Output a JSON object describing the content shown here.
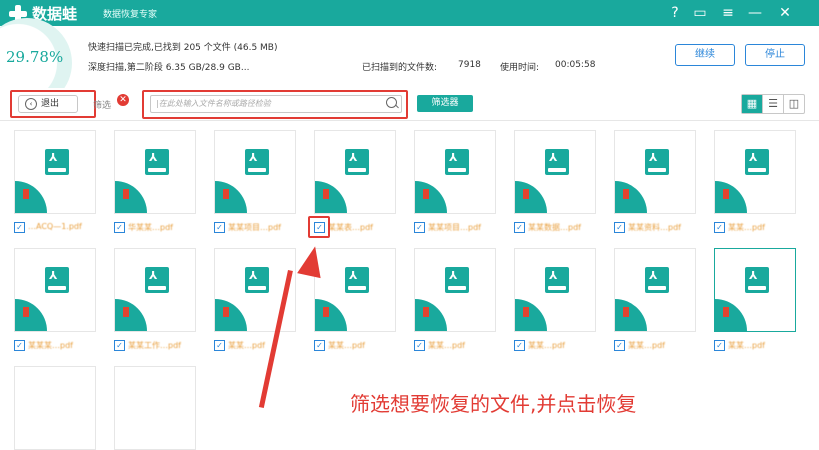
{
  "titlebar": {
    "app_name": "数据蛙",
    "subtitle": "数据恢复专家",
    "help_icon": "?",
    "save_icon": "▭",
    "menu_icon": "≡",
    "minimize_icon": "—",
    "close_icon": "✕"
  },
  "scan": {
    "percent": "29.78%",
    "quick_scan_text": "快速扫描已完成,已找到 205 个文件 (46.5 MB)",
    "deep_scan_text": "深度扫描,第二阶段 6.35 GB/28.9 GB...",
    "scanned_files_label": "已扫描到的文件数:",
    "scanned_files_value": "7918",
    "time_label": "使用时间:",
    "time_value": "00:05:58",
    "continue_label": "继续",
    "stop_label": "停止"
  },
  "toolbar": {
    "exit_label": "退出",
    "filter_label": "筛选",
    "search_placeholder": "|在此处输入文件名称或路径检验",
    "filter_button_label": "筛选器",
    "view_grid_icon": "▦",
    "view_list_icon": "☰",
    "view_detail_icon": "◫"
  },
  "files": {
    "row1": [
      {
        "name": "…ACQ—1.pdf",
        "checked": "✓"
      },
      {
        "name": "华某某…pdf",
        "checked": "✓"
      },
      {
        "name": "某某项目…pdf",
        "checked": "✓"
      },
      {
        "name": "某某表…pdf",
        "checked": "✓"
      },
      {
        "name": "某某项目…pdf",
        "checked": "✓"
      },
      {
        "name": "某某数据…pdf",
        "checked": "✓"
      },
      {
        "name": "某某资料…pdf",
        "checked": "✓"
      },
      {
        "name": "某某…pdf",
        "checked": "✓"
      }
    ],
    "row2": [
      {
        "name": "某某某…pdf",
        "checked": "✓"
      },
      {
        "name": "某某工作…pdf",
        "checked": "✓"
      },
      {
        "name": "某某…pdf",
        "checked": "✓"
      },
      {
        "name": "某某…pdf",
        "checked": "✓"
      },
      {
        "name": "某某…pdf",
        "checked": "✓"
      },
      {
        "name": "某某…pdf",
        "checked": "✓"
      },
      {
        "name": "某某…pdf",
        "checked": "✓"
      },
      {
        "name": "某某…pdf",
        "checked": "✓"
      }
    ]
  },
  "annotation": {
    "text": "筛选想要恢复的文件,并点击恢复",
    "color": "#e23b34"
  },
  "colors": {
    "brand": "#19a99d",
    "accent_blue": "#2b86d9",
    "highlight_red": "#e23b34"
  }
}
